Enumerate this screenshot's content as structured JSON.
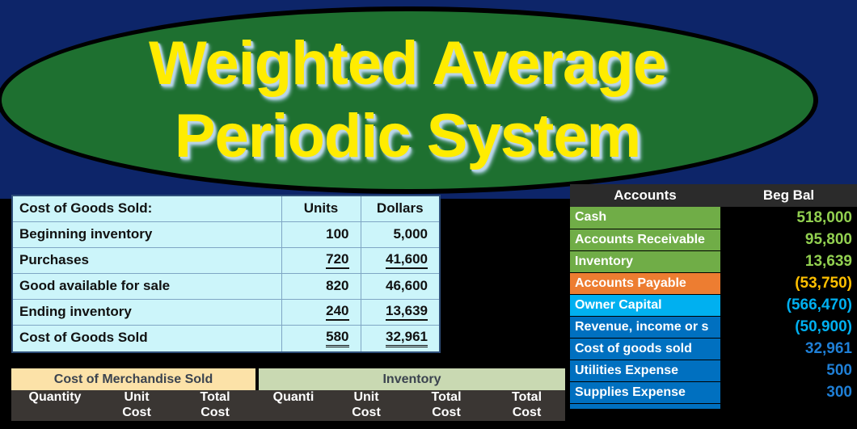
{
  "theme": {
    "background_navy": "#0d2569",
    "background_black": "#000000",
    "ellipse_green": "#1e7030",
    "title_yellow": "#ffec00",
    "cogs_cell_cyan": "#ccf5fa",
    "group_cms_tan": "#fce2a8",
    "group_inventory_sage": "#c9d9b2",
    "accounts_header_gray": "#2b2b2b",
    "asset_green": "#70ad47",
    "liability_orange": "#ed7d31",
    "equity_cyan": "#00b0f0",
    "income_blue": "#0070c0",
    "value_green": "#92d050",
    "value_gold": "#ffc000",
    "value_blue": "#1f7fd6"
  },
  "title": {
    "line1": "Weighted Average",
    "line2": "Periodic System"
  },
  "cogs_table": {
    "header": {
      "label": "Cost of Goods Sold:",
      "units": "Units",
      "dollars": "Dollars"
    },
    "rows": [
      {
        "label": "Beginning inventory",
        "units": "100",
        "dollars": "5,000",
        "underline": "none"
      },
      {
        "label": "Purchases",
        "units": "720",
        "dollars": "41,600",
        "underline": "single"
      },
      {
        "label": "Good available for sale",
        "units": "820",
        "dollars": "46,600",
        "underline": "none"
      },
      {
        "label": "Ending inventory",
        "units": "240",
        "dollars": "13,639",
        "underline": "single"
      },
      {
        "label": "Cost of Goods Sold",
        "units": "580",
        "dollars": "32,961",
        "underline": "double"
      }
    ]
  },
  "inventory_table": {
    "groups": [
      {
        "label": "Cost of Merchandise Sold"
      },
      {
        "label": "Inventory"
      }
    ],
    "subheaders": [
      {
        "line1": "",
        "line2": "Quantity"
      },
      {
        "line1": "Unit",
        "line2": "Cost"
      },
      {
        "line1": "Total",
        "line2": "Cost"
      },
      {
        "line1": "",
        "line2": "Quanti"
      },
      {
        "line1": "Unit",
        "line2": "Cost"
      },
      {
        "line1": "Total",
        "line2": "Cost"
      },
      {
        "line1": "Total",
        "line2": "Cost"
      }
    ]
  },
  "accounts_table": {
    "header": {
      "accounts": "Accounts",
      "beg_bal": "Beg Bal"
    },
    "rows": [
      {
        "name": "Cash",
        "value": "518,000",
        "name_color": "c-green",
        "value_color": "v-green"
      },
      {
        "name": "Accounts Receivable",
        "value": "95,800",
        "name_color": "c-green",
        "value_color": "v-green"
      },
      {
        "name": "Inventory",
        "value": "13,639",
        "name_color": "c-green",
        "value_color": "v-green"
      },
      {
        "name": "Accounts Payable",
        "value": "(53,750)",
        "name_color": "c-orange",
        "value_color": "v-gold"
      },
      {
        "name": "Owner Capital",
        "value": "(566,470)",
        "name_color": "c-cyan",
        "value_color": "v-cyan"
      },
      {
        "name": "Revenue, income or s",
        "value": "(50,900)",
        "name_color": "c-blue",
        "value_color": "v-cyan"
      },
      {
        "name": "Cost of goods sold",
        "value": "32,961",
        "name_color": "c-blue",
        "value_color": "v-blue"
      },
      {
        "name": "Utilities Expense",
        "value": "500",
        "name_color": "c-blue",
        "value_color": "v-blue"
      },
      {
        "name": "Supplies Expense",
        "value": "300",
        "name_color": "c-blue",
        "value_color": "v-blue"
      }
    ]
  }
}
